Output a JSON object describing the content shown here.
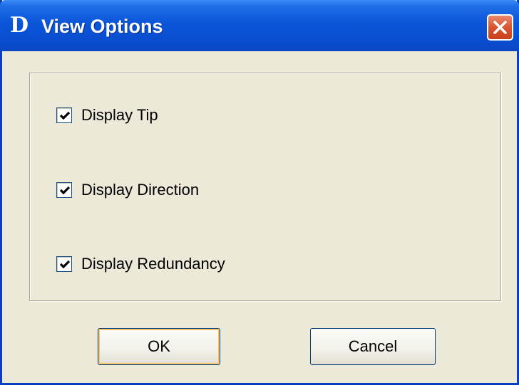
{
  "window": {
    "logo": "D",
    "title": "View Options",
    "close_icon": "close-icon"
  },
  "options": [
    {
      "label": "Display Tip",
      "checked": true
    },
    {
      "label": "Display Direction",
      "checked": true
    },
    {
      "label": "Display Redundancy",
      "checked": true
    }
  ],
  "buttons": {
    "ok_label": "OK",
    "cancel_label": "Cancel"
  },
  "colors": {
    "titlebar": "#0b55d9",
    "window_bg": "#ece9d8",
    "close_button": "#d9552e"
  }
}
